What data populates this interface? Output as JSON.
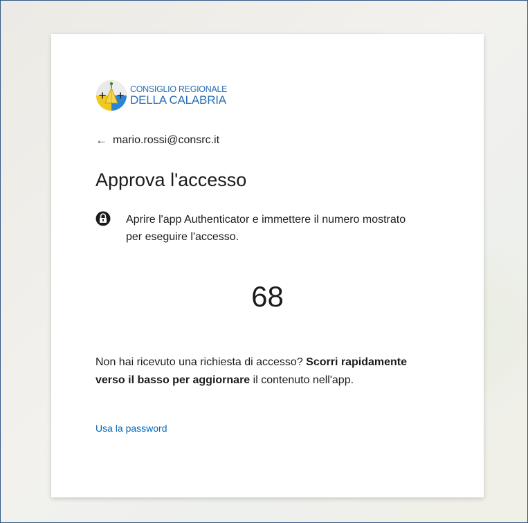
{
  "logo": {
    "line1": "CONSIGLIO REGIONALE",
    "line2": "DELLA CALABRIA",
    "emblem_icon": "calabria-coat-of-arms",
    "brand_color": "#2a6db5",
    "emblem_gold": "#f2c81c"
  },
  "identity": {
    "back_icon": "arrow-left-icon",
    "back_glyph": "←",
    "email": "mario.rossi@consrc.it"
  },
  "title": "Approva l'accesso",
  "instruction": {
    "icon": "lock-icon",
    "text": "Aprire l'app Authenticator e immettere il numero mostrato per eseguire l'accesso."
  },
  "auth_number": "68",
  "help": {
    "prefix": "Non hai ricevuto una richiesta di accesso? ",
    "bold": "Scorri rapidamente verso il basso per aggiornare",
    "suffix": " il contenuto nell'app."
  },
  "links": {
    "use_password": "Usa la password",
    "link_color": "#0067b8"
  }
}
